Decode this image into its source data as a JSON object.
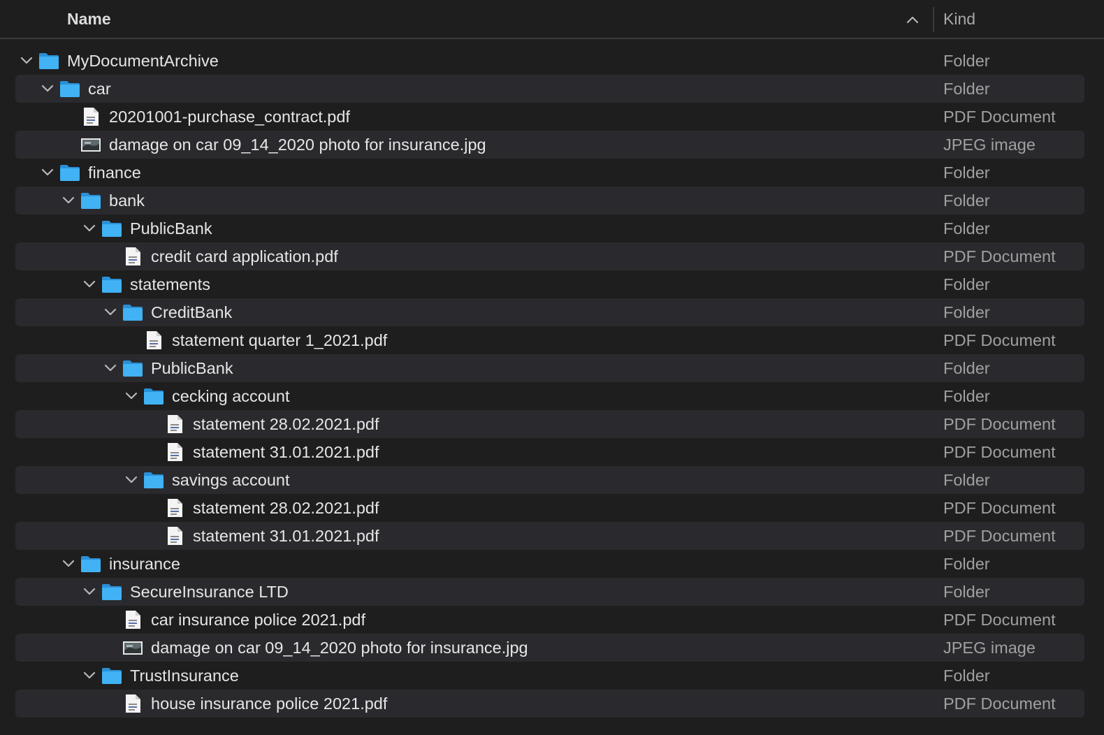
{
  "header": {
    "name_label": "Name",
    "kind_label": "Kind",
    "sort_icon": "chevron-up-icon"
  },
  "colors": {
    "background": "#1e1e1e",
    "stripe": "#2a2a2e",
    "folder_blue": "#3fb0f3",
    "text": "#e6e6e6",
    "kind_text": "#a0a0a0"
  },
  "items": [
    {
      "name": "MyDocumentArchive",
      "kind": "Folder",
      "type": "folder",
      "depth": 0,
      "expanded": true
    },
    {
      "name": "car",
      "kind": "Folder",
      "type": "folder",
      "depth": 1,
      "expanded": true
    },
    {
      "name": "20201001-purchase_contract.pdf",
      "kind": "PDF Document",
      "type": "pdf",
      "depth": 2
    },
    {
      "name": "damage on car 09_14_2020 photo for insurance.jpg",
      "kind": "JPEG image",
      "type": "jpg",
      "depth": 2
    },
    {
      "name": "finance",
      "kind": "Folder",
      "type": "folder",
      "depth": 1,
      "expanded": true
    },
    {
      "name": "bank",
      "kind": "Folder",
      "type": "folder",
      "depth": 2,
      "expanded": true
    },
    {
      "name": "PublicBank",
      "kind": "Folder",
      "type": "folder",
      "depth": 3,
      "expanded": true
    },
    {
      "name": "credit card application.pdf",
      "kind": "PDF Document",
      "type": "pdf",
      "depth": 4
    },
    {
      "name": "statements",
      "kind": "Folder",
      "type": "folder",
      "depth": 3,
      "expanded": true
    },
    {
      "name": "CreditBank",
      "kind": "Folder",
      "type": "folder",
      "depth": 4,
      "expanded": true
    },
    {
      "name": "statement quarter 1_2021.pdf",
      "kind": "PDF Document",
      "type": "pdf",
      "depth": 5
    },
    {
      "name": "PublicBank",
      "kind": "Folder",
      "type": "folder",
      "depth": 4,
      "expanded": true
    },
    {
      "name": "cecking account",
      "kind": "Folder",
      "type": "folder",
      "depth": 5,
      "expanded": true
    },
    {
      "name": "statement 28.02.2021.pdf",
      "kind": "PDF Document",
      "type": "pdf",
      "depth": 6
    },
    {
      "name": "statement 31.01.2021.pdf",
      "kind": "PDF Document",
      "type": "pdf",
      "depth": 6
    },
    {
      "name": "savings account",
      "kind": "Folder",
      "type": "folder",
      "depth": 5,
      "expanded": true
    },
    {
      "name": "statement 28.02.2021.pdf",
      "kind": "PDF Document",
      "type": "pdf",
      "depth": 6
    },
    {
      "name": "statement 31.01.2021.pdf",
      "kind": "PDF Document",
      "type": "pdf",
      "depth": 6
    },
    {
      "name": "insurance",
      "kind": "Folder",
      "type": "folder",
      "depth": 2,
      "expanded": true
    },
    {
      "name": "SecureInsurance LTD",
      "kind": "Folder",
      "type": "folder",
      "depth": 3,
      "expanded": true
    },
    {
      "name": "car insurance police 2021.pdf",
      "kind": "PDF Document",
      "type": "pdf",
      "depth": 4
    },
    {
      "name": "damage on car 09_14_2020 photo for insurance.jpg",
      "kind": "JPEG image",
      "type": "jpg",
      "depth": 4
    },
    {
      "name": "TrustInsurance",
      "kind": "Folder",
      "type": "folder",
      "depth": 3,
      "expanded": true
    },
    {
      "name": "house insurance police 2021.pdf",
      "kind": "PDF Document",
      "type": "pdf",
      "depth": 4
    }
  ]
}
